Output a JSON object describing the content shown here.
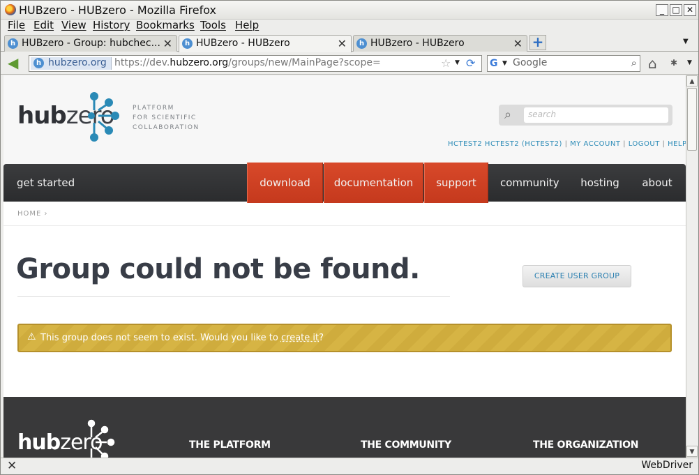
{
  "window": {
    "title": "HUBzero - HUBzero - Mozilla Firefox",
    "minimize": "_",
    "maximize": "□",
    "close": "✕"
  },
  "menu": [
    "File",
    "Edit",
    "View",
    "History",
    "Bookmarks",
    "Tools",
    "Help"
  ],
  "tabs": [
    {
      "label": "HUBzero - Group: hubchec...",
      "active": false
    },
    {
      "label": "HUBzero - HUBzero",
      "active": true
    },
    {
      "label": "HUBzero - HUBzero",
      "active": false
    }
  ],
  "newtab": "+",
  "navbar": {
    "identity": "hubzero.org",
    "url_prefix": "https://dev.",
    "url_domain": "hubzero.org",
    "url_path": "/groups/new/MainPage?scope=",
    "search_placeholder": "Google"
  },
  "header": {
    "logo_bold": "hub",
    "logo_light": "zero",
    "tagline": [
      "PLATFORM",
      "FOR SCIENTIFIC",
      "COLLABORATION"
    ],
    "search_placeholder": "search",
    "user_links": [
      "HCTEST2 HCTEST2 (HCTEST2)",
      "MY ACCOUNT",
      "LOGOUT",
      "HELP"
    ],
    "user_links_sep": " | "
  },
  "nav": {
    "get_started": "get started",
    "download": "download",
    "documentation": "documentation",
    "support": "support",
    "community": "community",
    "hosting": "hosting",
    "about": "about"
  },
  "breadcrumb": {
    "home": "HOME",
    "sep": "›"
  },
  "main": {
    "title": "Group could not be found.",
    "create_button": "CREATE USER GROUP",
    "warning_before": "This group does not seem to exist. Would you like to ",
    "warning_link": "create it",
    "warning_after": "?"
  },
  "footer": {
    "logo_bold": "hub",
    "logo_light": "zero",
    "columns": [
      "THE PLATFORM",
      "THE COMMUNITY",
      "THE ORGANIZATION"
    ]
  },
  "status": {
    "driver": "WebDriver"
  },
  "colors": {
    "accent_red": "#c9401f",
    "link_blue": "#2a8ab6",
    "warning_gold": "#d3b040",
    "nav_dark": "#333436"
  }
}
